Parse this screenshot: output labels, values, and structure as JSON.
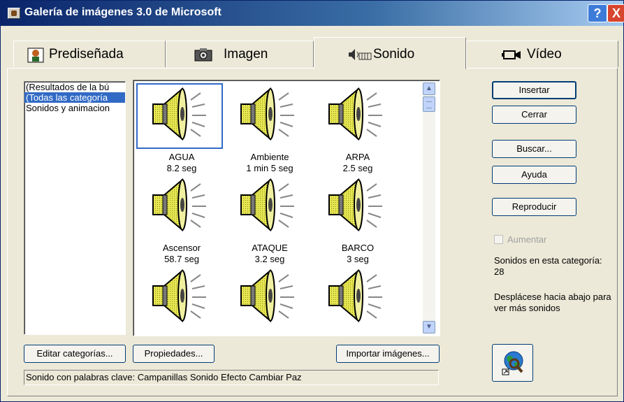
{
  "window": {
    "title": "Galería de imágenes 3.0 de Microsoft",
    "help_button": "?",
    "close_button": "X"
  },
  "tabs": [
    {
      "label": "Prediseñada",
      "icon": "clipart-icon"
    },
    {
      "label": "Imagen",
      "icon": "camera-icon"
    },
    {
      "label": "Sonido",
      "icon": "sound-icon",
      "active": true
    },
    {
      "label": "Vídeo",
      "icon": "video-camera-icon"
    }
  ],
  "categories": [
    {
      "label": "(Resultados de la bú",
      "selected": false
    },
    {
      "label": "(Todas las categoría",
      "selected": true
    },
    {
      "label": "Sonidos y animacion",
      "selected": false
    }
  ],
  "sounds": [
    {
      "name": "AGUA",
      "duration": "8.2 seg",
      "selected": true
    },
    {
      "name": "Ambiente",
      "duration": "1 min 5 seg"
    },
    {
      "name": "ARPA",
      "duration": "2.5 seg"
    },
    {
      "name": "Ascensor",
      "duration": "58.7 seg"
    },
    {
      "name": "ATAQUE",
      "duration": "3.2 seg"
    },
    {
      "name": "BARCO",
      "duration": "3 seg"
    },
    {
      "name": "",
      "duration": ""
    },
    {
      "name": "",
      "duration": ""
    },
    {
      "name": "",
      "duration": ""
    }
  ],
  "buttons": {
    "insert": "Insertar",
    "close": "Cerrar",
    "search": "Buscar...",
    "help": "Ayuda",
    "play": "Reproducir",
    "edit_categories": "Editar categorías...",
    "properties": "Propiedades...",
    "import_images": "Importar imágenes..."
  },
  "enlarge_checkbox": {
    "label": "Aumentar",
    "checked": false,
    "enabled": false
  },
  "info": {
    "count_text": "Sonidos en esta categoría: 28",
    "scroll_hint": "Desplácese hacia abajo para ver más sonidos"
  },
  "status_bar": {
    "text": "Sonido con palabras clave:  Campanillas Sonido Efecto Cambiar Paz"
  },
  "colors": {
    "title_gradient_start": "#0a246a",
    "selection": "#316ac5",
    "face": "#ece9d8"
  }
}
